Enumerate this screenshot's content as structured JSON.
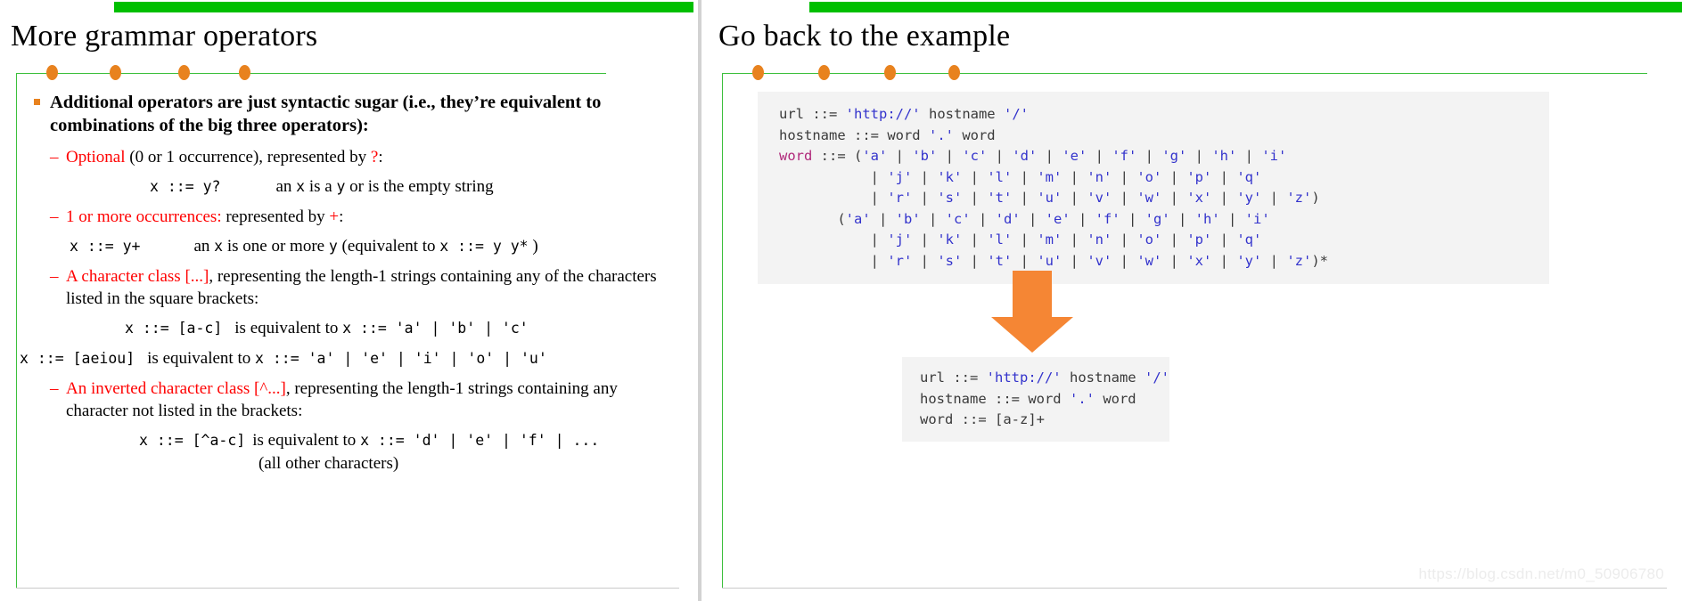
{
  "slides": [
    {
      "title": "More grammar operators",
      "bullet_main": "Additional operators are just syntactic sugar (i.e., they’re equivalent to combinations of the big three operators):",
      "items": [
        {
          "dash": "–",
          "red_lead": "Optional",
          "rest": " (0 or 1 occurrence), represented by ",
          "red_tail": "?",
          "tail": ":"
        },
        {
          "dash": "–",
          "red_lead": "1 or more occurrences:",
          "rest": " represented by ",
          "red_tail": "+",
          "tail": ":"
        },
        {
          "dash": "–",
          "red_lead": "A character class [...]",
          "rest": ", representing the length-1 strings containing any of the characters listed in the square brackets:",
          "red_tail": "",
          "tail": ""
        },
        {
          "dash": "–",
          "red_lead": "An inverted character class [^...]",
          "rest": ", representing the length-1 strings containing any character not listed in the brackets:",
          "red_tail": "",
          "tail": ""
        }
      ],
      "examples": {
        "ex1_mono": "x ::=  y?",
        "ex1_text": "an ",
        "ex1_x": "x",
        "ex1_text2": " is a ",
        "ex1_y": "y",
        "ex1_text3": " or is the empty string",
        "ex2_mono": "x ::= y+",
        "ex2_text": "an ",
        "ex2_x": "x",
        "ex2_text2": " is one or more ",
        "ex2_y": "y",
        "ex2_text3": "  (equivalent to ",
        "ex2_mono2": "x ::= y y*",
        "ex2_text4": " )",
        "ex3_mono": "x ::= [a-c]",
        "ex3_text": "is equivalent to ",
        "ex3_mono2": "x ::= 'a' | 'b' | 'c'",
        "ex4_mono": "x ::= [aeiou]",
        "ex4_text": "is equivalent to ",
        "ex4_mono2": "x ::= 'a' | 'e' | 'i' | 'o' | 'u'",
        "ex5_mono": "x ::= [^a-c]",
        "ex5_text": "is equivalent to ",
        "ex5_mono2": "x ::= 'd' | 'e' | 'f' | ...",
        "ex5_note": "(all other characters)"
      }
    },
    {
      "title": "Go back to the example",
      "code_before": [
        {
          "segments": [
            {
              "t": "url ::= ",
              "c": "plain"
            },
            {
              "t": "'http://'",
              "c": "str"
            },
            {
              "t": " hostname ",
              "c": "plain"
            },
            {
              "t": "'/'",
              "c": "str"
            }
          ]
        },
        {
          "segments": [
            {
              "t": "hostname ::= word ",
              "c": "plain"
            },
            {
              "t": "'.'",
              "c": "str"
            },
            {
              "t": " word",
              "c": "plain"
            }
          ]
        },
        {
          "segments": [
            {
              "t": "word",
              "c": "kw"
            },
            {
              "t": " ::= (",
              "c": "plain"
            },
            {
              "t": "'a'",
              "c": "str"
            },
            {
              "t": " | ",
              "c": "plain"
            },
            {
              "t": "'b'",
              "c": "str"
            },
            {
              "t": " | ",
              "c": "plain"
            },
            {
              "t": "'c'",
              "c": "str"
            },
            {
              "t": " | ",
              "c": "plain"
            },
            {
              "t": "'d'",
              "c": "str"
            },
            {
              "t": " | ",
              "c": "plain"
            },
            {
              "t": "'e'",
              "c": "str"
            },
            {
              "t": " | ",
              "c": "plain"
            },
            {
              "t": "'f'",
              "c": "str"
            },
            {
              "t": " | ",
              "c": "plain"
            },
            {
              "t": "'g'",
              "c": "str"
            },
            {
              "t": " | ",
              "c": "plain"
            },
            {
              "t": "'h'",
              "c": "str"
            },
            {
              "t": " | ",
              "c": "plain"
            },
            {
              "t": "'i'",
              "c": "str"
            }
          ]
        },
        {
          "segments": [
            {
              "t": "           | ",
              "c": "plain"
            },
            {
              "t": "'j'",
              "c": "str"
            },
            {
              "t": " | ",
              "c": "plain"
            },
            {
              "t": "'k'",
              "c": "str"
            },
            {
              "t": " | ",
              "c": "plain"
            },
            {
              "t": "'l'",
              "c": "str"
            },
            {
              "t": " | ",
              "c": "plain"
            },
            {
              "t": "'m'",
              "c": "str"
            },
            {
              "t": " | ",
              "c": "plain"
            },
            {
              "t": "'n'",
              "c": "str"
            },
            {
              "t": " | ",
              "c": "plain"
            },
            {
              "t": "'o'",
              "c": "str"
            },
            {
              "t": " | ",
              "c": "plain"
            },
            {
              "t": "'p'",
              "c": "str"
            },
            {
              "t": " | ",
              "c": "plain"
            },
            {
              "t": "'q'",
              "c": "str"
            }
          ]
        },
        {
          "segments": [
            {
              "t": "           | ",
              "c": "plain"
            },
            {
              "t": "'r'",
              "c": "str"
            },
            {
              "t": " | ",
              "c": "plain"
            },
            {
              "t": "'s'",
              "c": "str"
            },
            {
              "t": " | ",
              "c": "plain"
            },
            {
              "t": "'t'",
              "c": "str"
            },
            {
              "t": " | ",
              "c": "plain"
            },
            {
              "t": "'u'",
              "c": "str"
            },
            {
              "t": " | ",
              "c": "plain"
            },
            {
              "t": "'v'",
              "c": "str"
            },
            {
              "t": " | ",
              "c": "plain"
            },
            {
              "t": "'w'",
              "c": "str"
            },
            {
              "t": " | ",
              "c": "plain"
            },
            {
              "t": "'x'",
              "c": "str"
            },
            {
              "t": " | ",
              "c": "plain"
            },
            {
              "t": "'y'",
              "c": "str"
            },
            {
              "t": " | ",
              "c": "plain"
            },
            {
              "t": "'z'",
              "c": "str"
            },
            {
              "t": ")",
              "c": "plain"
            }
          ]
        },
        {
          "segments": [
            {
              "t": "       (",
              "c": "plain"
            },
            {
              "t": "'a'",
              "c": "str"
            },
            {
              "t": " | ",
              "c": "plain"
            },
            {
              "t": "'b'",
              "c": "str"
            },
            {
              "t": " | ",
              "c": "plain"
            },
            {
              "t": "'c'",
              "c": "str"
            },
            {
              "t": " | ",
              "c": "plain"
            },
            {
              "t": "'d'",
              "c": "str"
            },
            {
              "t": " | ",
              "c": "plain"
            },
            {
              "t": "'e'",
              "c": "str"
            },
            {
              "t": " | ",
              "c": "plain"
            },
            {
              "t": "'f'",
              "c": "str"
            },
            {
              "t": " | ",
              "c": "plain"
            },
            {
              "t": "'g'",
              "c": "str"
            },
            {
              "t": " | ",
              "c": "plain"
            },
            {
              "t": "'h'",
              "c": "str"
            },
            {
              "t": " | ",
              "c": "plain"
            },
            {
              "t": "'i'",
              "c": "str"
            }
          ]
        },
        {
          "segments": [
            {
              "t": "           | ",
              "c": "plain"
            },
            {
              "t": "'j'",
              "c": "str"
            },
            {
              "t": " | ",
              "c": "plain"
            },
            {
              "t": "'k'",
              "c": "str"
            },
            {
              "t": " | ",
              "c": "plain"
            },
            {
              "t": "'l'",
              "c": "str"
            },
            {
              "t": " | ",
              "c": "plain"
            },
            {
              "t": "'m'",
              "c": "str"
            },
            {
              "t": " | ",
              "c": "plain"
            },
            {
              "t": "'n'",
              "c": "str"
            },
            {
              "t": " | ",
              "c": "plain"
            },
            {
              "t": "'o'",
              "c": "str"
            },
            {
              "t": " | ",
              "c": "plain"
            },
            {
              "t": "'p'",
              "c": "str"
            },
            {
              "t": " | ",
              "c": "plain"
            },
            {
              "t": "'q'",
              "c": "str"
            }
          ]
        },
        {
          "segments": [
            {
              "t": "           | ",
              "c": "plain"
            },
            {
              "t": "'r'",
              "c": "str"
            },
            {
              "t": " | ",
              "c": "plain"
            },
            {
              "t": "'s'",
              "c": "str"
            },
            {
              "t": " | ",
              "c": "plain"
            },
            {
              "t": "'t'",
              "c": "str"
            },
            {
              "t": " | ",
              "c": "plain"
            },
            {
              "t": "'u'",
              "c": "str"
            },
            {
              "t": " | ",
              "c": "plain"
            },
            {
              "t": "'v'",
              "c": "str"
            },
            {
              "t": " | ",
              "c": "plain"
            },
            {
              "t": "'w'",
              "c": "str"
            },
            {
              "t": " | ",
              "c": "plain"
            },
            {
              "t": "'x'",
              "c": "str"
            },
            {
              "t": " | ",
              "c": "plain"
            },
            {
              "t": "'y'",
              "c": "str"
            },
            {
              "t": " | ",
              "c": "plain"
            },
            {
              "t": "'z'",
              "c": "str"
            },
            {
              "t": ")*",
              "c": "plain"
            }
          ]
        }
      ],
      "code_after": [
        {
          "segments": [
            {
              "t": "url ::= ",
              "c": "plain"
            },
            {
              "t": "'http://'",
              "c": "str"
            },
            {
              "t": " hostname ",
              "c": "plain"
            },
            {
              "t": "'/'",
              "c": "str"
            }
          ]
        },
        {
          "segments": [
            {
              "t": "hostname ::= word ",
              "c": "plain"
            },
            {
              "t": "'.'",
              "c": "str"
            },
            {
              "t": " word",
              "c": "plain"
            }
          ]
        },
        {
          "segments": [
            {
              "t": "word ::= [a-z]+",
              "c": "plain"
            }
          ]
        }
      ],
      "arrow_name": "down-arrow"
    }
  ],
  "watermark": "https://blog.csdn.net/m0_50906780",
  "colors": {
    "green_bar": "#00bf00",
    "green_rule": "#3dc03d",
    "orange_dot": "#e8821e",
    "arrow_orange": "#f58634",
    "red_text": "#ff0000",
    "code_bg": "#f3f3f3",
    "string_blue": "#3333cc",
    "keyword_magenta": "#b0287a"
  }
}
